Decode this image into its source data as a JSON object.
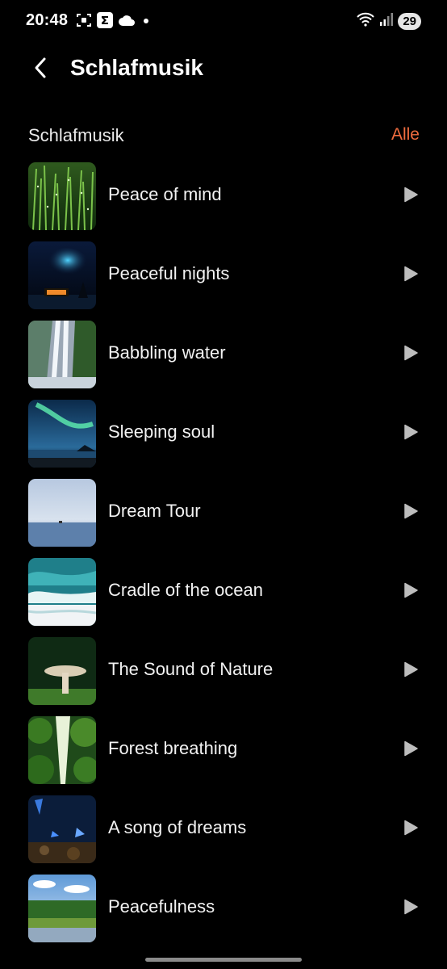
{
  "status_bar": {
    "time": "20:48",
    "battery_level": "29",
    "left_icons": [
      "screenshot-icon",
      "sigma-app-icon",
      "cloud-icon",
      "notification-dot-icon"
    ],
    "right_icons": [
      "wifi-icon",
      "signal-icon",
      "battery-icon"
    ]
  },
  "header": {
    "title": "Schlafmusik",
    "back_icon": "chevron-left-icon"
  },
  "section": {
    "title": "Schlafmusik",
    "all_label": "Alle",
    "accent_color": "#ef6c3f"
  },
  "tracks": [
    {
      "title": "Peace of mind",
      "thumbnail": "grass"
    },
    {
      "title": "Peaceful nights",
      "thumbnail": "aurora-cabin"
    },
    {
      "title": "Babbling water",
      "thumbnail": "waterfall"
    },
    {
      "title": "Sleeping soul",
      "thumbnail": "aurora-sea"
    },
    {
      "title": "Dream Tour",
      "thumbnail": "sea-boat"
    },
    {
      "title": "Cradle of the ocean",
      "thumbnail": "wave"
    },
    {
      "title": "The Sound of Nature",
      "thumbnail": "mushroom"
    },
    {
      "title": "Forest breathing",
      "thumbnail": "forest-canopy"
    },
    {
      "title": "A song of dreams",
      "thumbnail": "blue-butterflies"
    },
    {
      "title": "Peacefulness",
      "thumbnail": "lake-forest"
    }
  ]
}
